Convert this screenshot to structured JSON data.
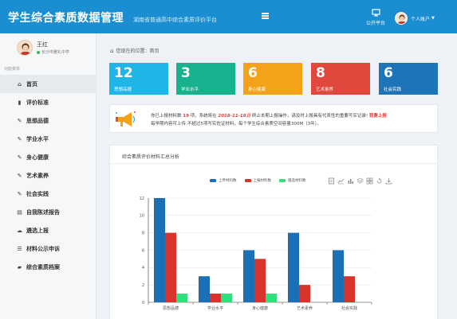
{
  "header": {
    "title": "学生综合素质数据管理",
    "subtitle": "湖南省普通高中综合素质评价平台",
    "public_platform": "公开平台",
    "account": "个人账户"
  },
  "user": {
    "name": "王红",
    "school": "长沙市雅礼中学"
  },
  "nav_caption": "功能菜单",
  "nav": [
    {
      "label": "首页",
      "icon": "home-icon"
    },
    {
      "label": "评价标准",
      "icon": "book-icon"
    },
    {
      "label": "思想品德",
      "icon": "edit-icon"
    },
    {
      "label": "学业水平",
      "icon": "edit-icon"
    },
    {
      "label": "身心健康",
      "icon": "edit-icon"
    },
    {
      "label": "艺术素养",
      "icon": "edit-icon"
    },
    {
      "label": "社会实践",
      "icon": "edit-icon"
    },
    {
      "label": "自我陈述报告",
      "icon": "doc-icon"
    },
    {
      "label": "遴选上报",
      "icon": "upload-icon"
    },
    {
      "label": "材料公示申诉",
      "icon": "list-icon"
    },
    {
      "label": "综合素质档案",
      "icon": "archive-icon"
    }
  ],
  "breadcrumb": {
    "prefix": "您现在的位置：",
    "current": "首页"
  },
  "cards": [
    {
      "value": "12",
      "label": "思想品德",
      "color": "#1fb5e6"
    },
    {
      "value": "3",
      "label": "学业水平",
      "color": "#19b28e"
    },
    {
      "value": "6",
      "label": "身心健康",
      "color": "#f5a21b"
    },
    {
      "value": "8",
      "label": "艺术素养",
      "color": "#e0473d"
    },
    {
      "value": "6",
      "label": "社会实践",
      "color": "#1f74b8"
    }
  ],
  "notice": {
    "p1": "你已上报材料数 ",
    "count": "19",
    "p2": " 项，系统将在 ",
    "date": "2018-11-18日",
    "p3": " 终止本期上报操作，请及时上报具有代表性的重要写实记录!",
    "action": "我要上报",
    "line2": "每学期内容可上传:不超过5项写实佐证材料，每个学生综合素质空间容量300M（3年）。"
  },
  "chart_panel_title": "综合素质评价材料汇总分析",
  "chart_data": {
    "type": "bar",
    "categories": [
      "思想品德",
      "学业水平",
      "身心健康",
      "艺术素养",
      "社会实践"
    ],
    "series": [
      {
        "name": "上传材料数",
        "values": [
          12,
          3,
          6,
          8,
          6
        ],
        "color": "#1a6fb5"
      },
      {
        "name": "上报材料数",
        "values": [
          8,
          1,
          5,
          2,
          3
        ],
        "color": "#d9342b"
      },
      {
        "name": "遴选材料数",
        "values": [
          1,
          1,
          1,
          0,
          0
        ],
        "color": "#2fe07c"
      }
    ],
    "ylim": [
      0,
      12
    ],
    "yticks": [
      0,
      2,
      4,
      6,
      8,
      10,
      12
    ],
    "legend": "top",
    "grid": true
  },
  "toolbox_icons": [
    "data-view-icon",
    "line-chart-icon",
    "bar-chart-icon",
    "stack-icon",
    "tiled-icon",
    "restore-icon",
    "save-image-icon"
  ]
}
